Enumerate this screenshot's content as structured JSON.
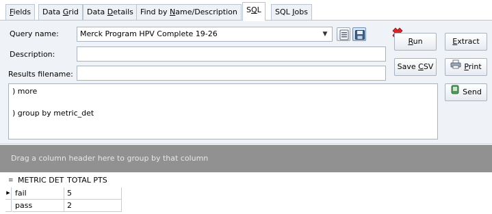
{
  "tabs": [
    {
      "pre": "",
      "mn": "F",
      "post": "ields"
    },
    {
      "pre": "Data ",
      "mn": "G",
      "post": "rid"
    },
    {
      "pre": "Data ",
      "mn": "D",
      "post": "etails"
    },
    {
      "pre": "Find by ",
      "mn": "N",
      "post": "ame/Description"
    },
    {
      "pre": "S",
      "mn": "Q",
      "post": "L"
    },
    {
      "pre": "SQL ",
      "mn": "J",
      "post": "obs"
    }
  ],
  "form": {
    "query_name_label": "Query name:",
    "query_name_value": "Merck Program HPV Complete 19-26",
    "description_label": "Description:",
    "description_value": "",
    "results_filename_label": "Results filename:",
    "results_filename_value": ""
  },
  "toolbar_icons": [
    "save-template-icon",
    "save-icon",
    "delete-icon"
  ],
  "buttons": {
    "run": {
      "mn": "R",
      "post": "un"
    },
    "extract": {
      "mn": "E",
      "post": "xtract"
    },
    "save_csv": {
      "pre": "Save ",
      "mn": "C",
      "post": "SV"
    },
    "print": {
      "mn": "P",
      "post": "rint"
    },
    "send": "Send"
  },
  "sql_text": [
    ") more",
    ") group by metric_det"
  ],
  "group_panel_text": "Drag a column header here to group by that column",
  "grid": {
    "columns": [
      "METRIC DET",
      "TOTAL PTS"
    ],
    "rows": [
      {
        "metric": "fail",
        "total": "5"
      },
      {
        "metric": "pass",
        "total": "2"
      }
    ]
  },
  "colors": {
    "panel_bg": "#eff2f6",
    "group_bar": "#919191",
    "delete_red": "#d9262b"
  }
}
